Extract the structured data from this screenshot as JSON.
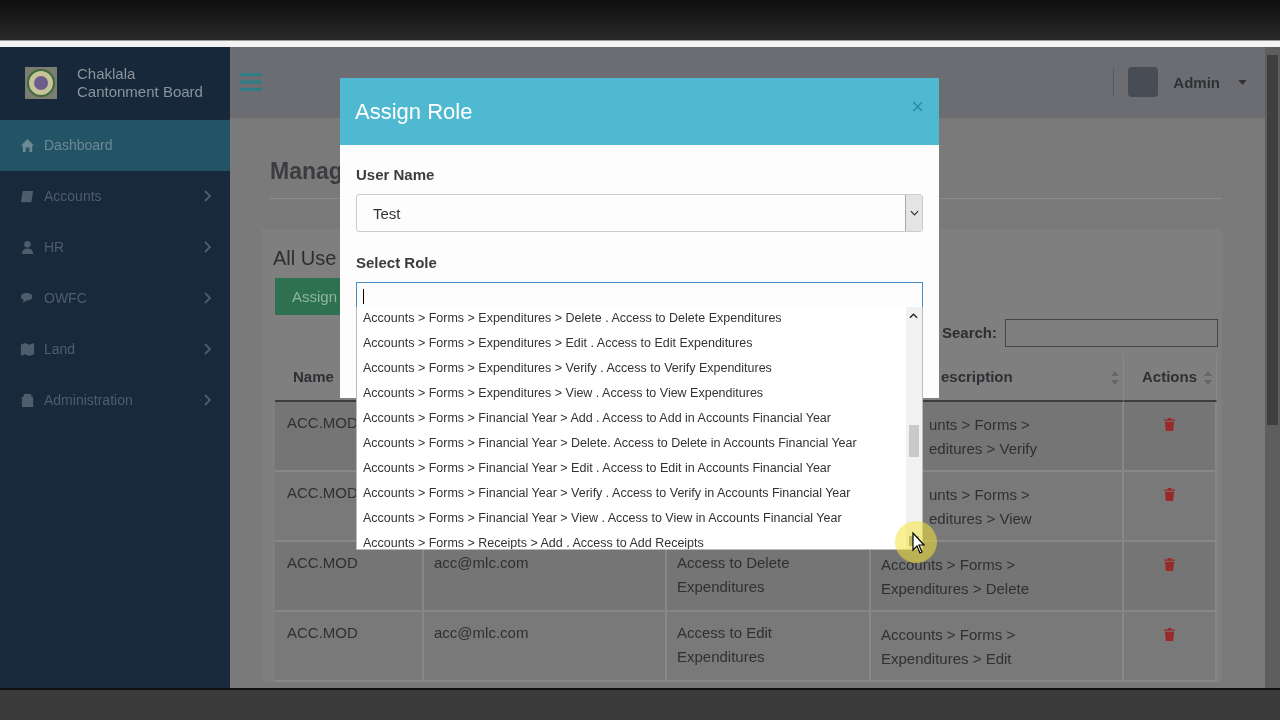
{
  "sidebar": {
    "brand": "Chaklala Cantonment Board",
    "items": [
      {
        "label": "Dashboard",
        "selected": true,
        "has_submenu": false
      },
      {
        "label": "Accounts",
        "selected": false,
        "has_submenu": true
      },
      {
        "label": "HR",
        "selected": false,
        "has_submenu": true
      },
      {
        "label": "OWFC",
        "selected": false,
        "has_submenu": true
      },
      {
        "label": "Land",
        "selected": false,
        "has_submenu": true
      },
      {
        "label": "Administration",
        "selected": false,
        "has_submenu": true
      }
    ]
  },
  "navbar": {
    "user": "Admin"
  },
  "page": {
    "title": "Manag",
    "card_title": "All Use",
    "assign_button": "Assign",
    "search_label": "Search:"
  },
  "table": {
    "columns": [
      "Name",
      "escription",
      "Actions"
    ],
    "rows": [
      {
        "name": "ACC.MOD",
        "module_visible": [
          "unts > Forms >",
          "editures > Verify"
        ]
      },
      {
        "name": "ACC.MOD",
        "module_visible": [
          "unts > Forms >",
          "editures > View"
        ]
      },
      {
        "name": "ACC.MOD",
        "email": "acc@mlc.com",
        "description": "Access to Delete Expenditures",
        "module": "Accounts > Forms > Expenditures > Delete"
      },
      {
        "name": "ACC.MOD",
        "email": "acc@mlc.com",
        "description": "Access to Edit Expenditures",
        "module": "Accounts > Forms > Expenditures > Edit"
      }
    ]
  },
  "modal": {
    "title": "Assign Role",
    "close": "×",
    "user_label": "User Name",
    "user_value": "Test",
    "role_label": "Select Role",
    "options": [
      {
        "label": "Accounts > Forms > Expenditures > Delete . Access to Delete Expenditures",
        "selected": false
      },
      {
        "label": "Accounts > Forms > Expenditures > Edit . Access to Edit Expenditures",
        "selected": false
      },
      {
        "label": "Accounts > Forms > Expenditures > Verify . Access to Verify Expenditures",
        "selected": false
      },
      {
        "label": "Accounts > Forms > Expenditures > View . Access to View Expenditures",
        "selected": false
      },
      {
        "label": "Accounts > Forms > Financial Year > Add . Access to Add in Accounts Financial Year",
        "selected": false
      },
      {
        "label": "Accounts > Forms > Financial Year > Delete. Access to Delete in Accounts Financial Year",
        "selected": false
      },
      {
        "label": "Accounts > Forms > Financial Year > Edit . Access to Edit in Accounts Financial Year",
        "selected": false
      },
      {
        "label": "Accounts > Forms > Financial Year > Verify . Access to Verify in Accounts Financial Year",
        "selected": false
      },
      {
        "label": "Accounts > Forms > Financial Year > View . Access to View in Accounts Financial Year",
        "selected": false
      },
      {
        "label": "Accounts > Forms > Receipts > Add . Access to Add Receipts",
        "selected": false
      }
    ]
  }
}
